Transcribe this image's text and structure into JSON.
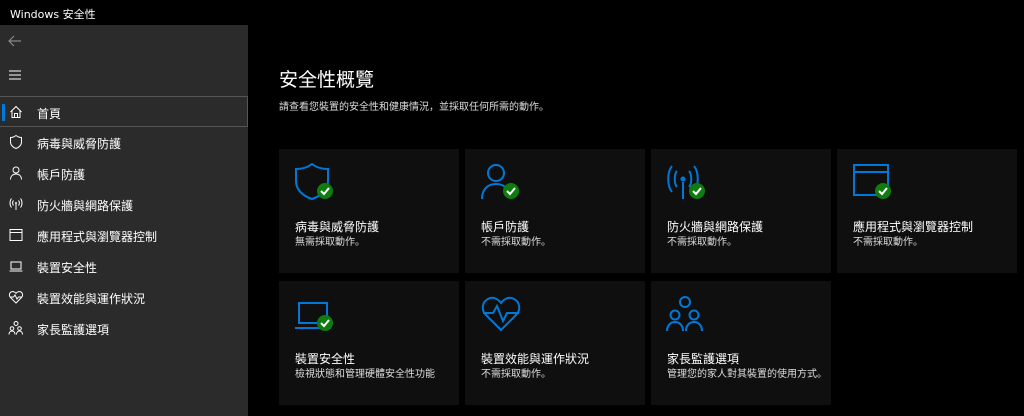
{
  "window": {
    "title": "Windows 安全性"
  },
  "sidebar": {
    "items": [
      {
        "label": "首頁",
        "icon": "home-icon"
      },
      {
        "label": "病毒與威脅防護",
        "icon": "shield-icon"
      },
      {
        "label": "帳戶防護",
        "icon": "person-icon"
      },
      {
        "label": "防火牆與網路保護",
        "icon": "antenna-icon"
      },
      {
        "label": "應用程式與瀏覽器控制",
        "icon": "app-window-icon"
      },
      {
        "label": "裝置安全性",
        "icon": "laptop-icon"
      },
      {
        "label": "裝置效能與運作狀況",
        "icon": "heart-icon"
      },
      {
        "label": "家長監護選項",
        "icon": "family-icon"
      }
    ]
  },
  "main": {
    "title": "安全性概覽",
    "subtitle": "請查看您裝置的安全性和健康情況，並採取任何所需的動作。",
    "tiles": [
      {
        "title": "病毒與威脅防護",
        "status": "無需採取動作。",
        "icon": "shield-icon"
      },
      {
        "title": "帳戶防護",
        "status": "不需採取動作。",
        "icon": "person-icon"
      },
      {
        "title": "防火牆與網路保護",
        "status": "不需採取動作。",
        "icon": "antenna-icon"
      },
      {
        "title": "應用程式與瀏覽器控制",
        "status": "不需採取動作。",
        "icon": "app-window-icon"
      },
      {
        "title": "裝置安全性",
        "status": "檢視狀態和管理硬體安全性功能",
        "icon": "laptop-icon"
      },
      {
        "title": "裝置效能與運作狀況",
        "status": "不需採取動作。",
        "icon": "heart-icon"
      },
      {
        "title": "家長監護選項",
        "status": "管理您的家人對其裝置的使用方式。",
        "icon": "family-icon"
      }
    ]
  },
  "colors": {
    "accent": "#0078d7",
    "ok": "#107c10",
    "sidebar": "#2b2b2b",
    "tile": "#0f0f0f"
  }
}
